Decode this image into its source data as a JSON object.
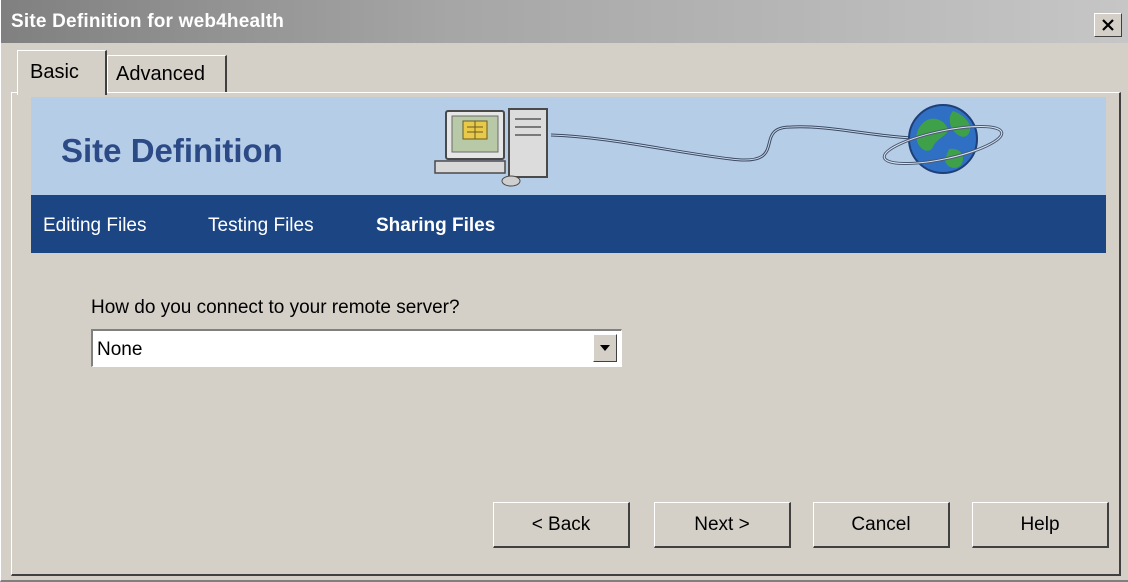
{
  "window": {
    "title": "Site Definition for web4health",
    "close_glyph": "close-icon"
  },
  "tabs": [
    {
      "label": "Basic",
      "active": true
    },
    {
      "label": "Advanced",
      "active": false
    }
  ],
  "banner": {
    "title": "Site Definition",
    "art_icons": [
      "computer-icon",
      "globe-icon"
    ],
    "colors": {
      "background": "#b6cde8",
      "title": "#2b4a86"
    }
  },
  "nav": {
    "items": [
      {
        "label": "Editing Files",
        "active": false
      },
      {
        "label": "Testing Files",
        "active": false
      },
      {
        "label": "Sharing Files",
        "active": true
      }
    ],
    "color": "#1c4584"
  },
  "form": {
    "question": "How do you connect to your remote server?",
    "selected": "None"
  },
  "buttons": {
    "back": "< Back",
    "next": "Next >",
    "cancel": "Cancel",
    "help": "Help"
  }
}
